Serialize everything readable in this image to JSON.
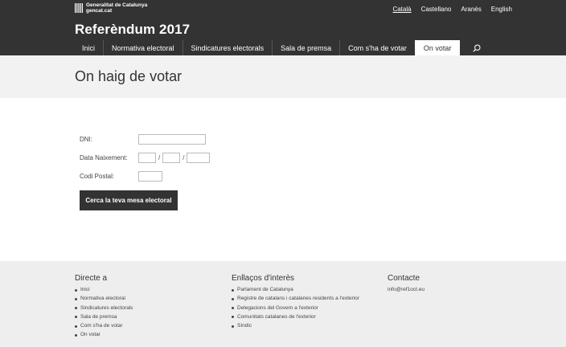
{
  "header": {
    "gov_logo_lines": [
      "Generalitat de Catalunya",
      "gencat.cat"
    ],
    "languages": [
      {
        "label": "Català",
        "active": true
      },
      {
        "label": "Castellano",
        "active": false
      },
      {
        "label": "Aranés",
        "active": false
      },
      {
        "label": "English",
        "active": false
      }
    ],
    "site_title": "Referèndum 2017",
    "nav": [
      {
        "label": "Inici",
        "active": false
      },
      {
        "label": "Normativa electoral",
        "active": false
      },
      {
        "label": "Sindicatures electorals",
        "active": false
      },
      {
        "label": "Sala de premsa",
        "active": false
      },
      {
        "label": "Com s'ha de votar",
        "active": false
      },
      {
        "label": "On votar",
        "active": true
      }
    ],
    "search_icon": "search-icon"
  },
  "page_title": "On haig de votar",
  "form": {
    "dni_label": "DNI:",
    "dob_label": "Data Naixement:",
    "dob_separator": "/",
    "postcode_label": "Codi Postal:",
    "submit_label": "Cerca la teva mesa electoral"
  },
  "footer": {
    "direct": {
      "title": "Directe a",
      "items": [
        "Inici",
        "Normativa electoral",
        "Sindicatures electorals",
        "Sala de premsa",
        "Com s'ha de votar",
        "On votar"
      ]
    },
    "links": {
      "title": "Enllaços d'interès",
      "items": [
        "Parlament de Catalunya",
        "Registre de catalans i catalanes residents a l'exterior",
        "Delegacions del Govern a l'exterior",
        "Comunitats catalanes de l'exterior",
        "Síndic"
      ]
    },
    "contact": {
      "title": "Contacte",
      "email": "info@ref1oct.eu"
    }
  },
  "colors": {
    "header_bg": "#333333",
    "title_band_bg": "#f2f2f2",
    "footer_bg": "#eeeeee",
    "button_bg": "#333333"
  }
}
